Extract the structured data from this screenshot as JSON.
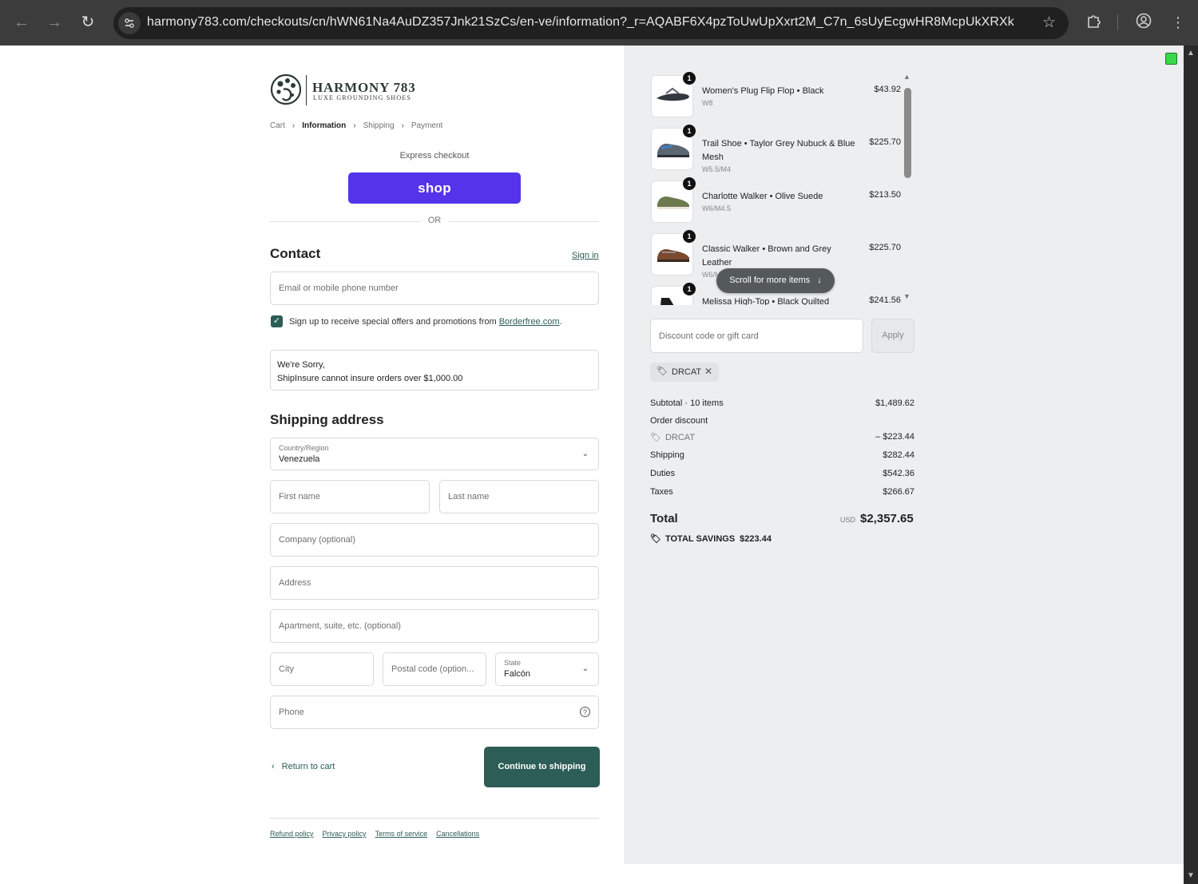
{
  "browser": {
    "url": "harmony783.com/checkouts/cn/hWN61Na4AuDZ357Jnk21SzCs/en-ve/information?_r=AQABF6X4pzToUwUpXxrt2M_C7n_6sUyEcgwHR8McpUkXRXk",
    "icons": [
      "back-arrow-icon",
      "forward-arrow-icon",
      "reload-icon",
      "site-info-icon",
      "bookmark-star-icon",
      "extensions-icon",
      "profile-icon",
      "menu-icon"
    ]
  },
  "brand": {
    "name": "HARMONY 783",
    "tagline": "LUXE GROUNDING SHOES"
  },
  "breadcrumb": {
    "cart": "Cart",
    "information": "Information",
    "shipping": "Shipping",
    "payment": "Payment"
  },
  "express": {
    "label": "Express checkout",
    "shop_button": "shop",
    "or": "OR"
  },
  "contact": {
    "title": "Contact",
    "sign_in": "Sign in",
    "email_placeholder": "Email or mobile phone number",
    "offers_text": "Sign up to receive special offers and promotions from ",
    "offers_link": "Borderfree.com",
    "offers_end": ".",
    "offers_checked": true
  },
  "notice": {
    "line1": "We're Sorry,",
    "line2": "ShipInsure cannot insure orders over $1,000.00"
  },
  "shipping": {
    "title": "Shipping address",
    "country_label": "Country/Region",
    "country_value": "Venezuela",
    "first_name": "First name",
    "last_name": "Last name",
    "company": "Company (optional)",
    "address": "Address",
    "apartment": "Apartment, suite, etc. (optional)",
    "city": "City",
    "postal": "Postal code (option...",
    "state_label": "State",
    "state_value": "Falcón",
    "phone": "Phone"
  },
  "actions": {
    "return_to_cart": "Return to cart",
    "continue": "Continue to shipping"
  },
  "footer": {
    "refund": "Refund policy",
    "privacy": "Privacy policy",
    "terms": "Terms of service",
    "cancellations": "Cancellations"
  },
  "cart": {
    "items": [
      {
        "qty": "1",
        "name": "Women's Plug Flip Flop • Black",
        "variant": "W8",
        "price": "$43.92"
      },
      {
        "qty": "1",
        "name": "Trail Shoe • Taylor Grey Nubuck & Blue Mesh",
        "variant": "W5.5/M4",
        "price": "$225.70"
      },
      {
        "qty": "1",
        "name": "Charlotte Walker • Olive Suede",
        "variant": "W6/M4.5",
        "price": "$213.50"
      },
      {
        "qty": "1",
        "name": "Classic Walker • Brown and Grey Leather",
        "variant": "W6/M4.5",
        "price": "$225.70"
      },
      {
        "qty": "1",
        "name": "Melissa High-Top • Black Quilted",
        "variant": "",
        "price": "$241.56"
      }
    ],
    "scroll_more": "Scroll for more items"
  },
  "discount": {
    "placeholder": "Discount code or gift card",
    "apply": "Apply",
    "applied_code": "DRCAT"
  },
  "summary": {
    "subtotal_label": "Subtotal · 10 items",
    "subtotal": "$1,489.62",
    "order_discount_label": "Order discount",
    "discount_code": "DRCAT",
    "discount_value": "– $223.44",
    "shipping_label": "Shipping",
    "shipping": "$282.44",
    "duties_label": "Duties",
    "duties": "$542.36",
    "taxes_label": "Taxes",
    "taxes": "$266.67",
    "total_label": "Total",
    "currency": "USD",
    "total": "$2,357.65",
    "savings_label": "TOTAL SAVINGS",
    "savings": "$223.44"
  },
  "colors": {
    "accent": "#2c5d56",
    "shop": "#5433eb",
    "summary_bg": "#eceef0"
  }
}
